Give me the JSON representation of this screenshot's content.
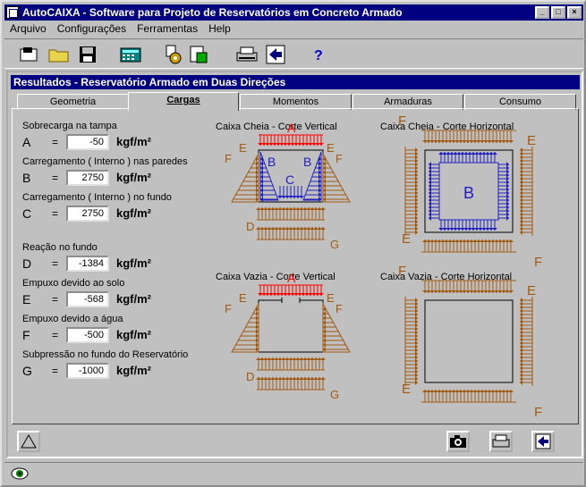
{
  "window": {
    "title": "AutoCAIXA - Software para Projeto de Reservatórios em Concreto Armado"
  },
  "menu": [
    "Arquivo",
    "Configurações",
    "Ferramentas",
    "Help"
  ],
  "panel": {
    "title": "Resultados - Reservatório Armado em Duas Direções"
  },
  "tabs": [
    "Geometria",
    "Cargas",
    "Momentos",
    "Armaduras",
    "Consumo"
  ],
  "active_tab": "Cargas",
  "eq_sign": "=",
  "unit": "kgf/m²",
  "fields": [
    {
      "caption": "Sobrecarga na tampa",
      "key": "A",
      "value": "-50"
    },
    {
      "caption": "Carregamento ( Interno ) nas paredes",
      "key": "B",
      "value": "2750"
    },
    {
      "caption": "Carregamento ( Interno ) no fundo",
      "key": "C",
      "value": "2750"
    },
    {
      "caption": "Reação no fundo",
      "key": "D",
      "value": "-1384"
    },
    {
      "caption": "Empuxo devido ao solo",
      "key": "E",
      "value": "-568"
    },
    {
      "caption": "Empuxo devido a água",
      "key": "F",
      "value": "-500"
    },
    {
      "caption": "Subpressão no fundo do Reservatório",
      "key": "G",
      "value": "-1000"
    }
  ],
  "diagrams": {
    "full_vertical": "Caixa Cheia - Corte Vertical",
    "full_horizontal": "Caixa Cheia - Corte Horizontal",
    "empty_vertical": "Caixa Vazia - Corte Vertical",
    "empty_horizontal": "Caixa Vazia - Corte Horizontal"
  },
  "diagram_letters": {
    "A": "A",
    "B": "B",
    "C": "C",
    "D": "D",
    "E": "E",
    "F": "F",
    "G": "G"
  },
  "colors": {
    "red": "#ff0000",
    "blue": "#2020c0",
    "brown": "#a05a10",
    "title_bg": "#000080"
  }
}
